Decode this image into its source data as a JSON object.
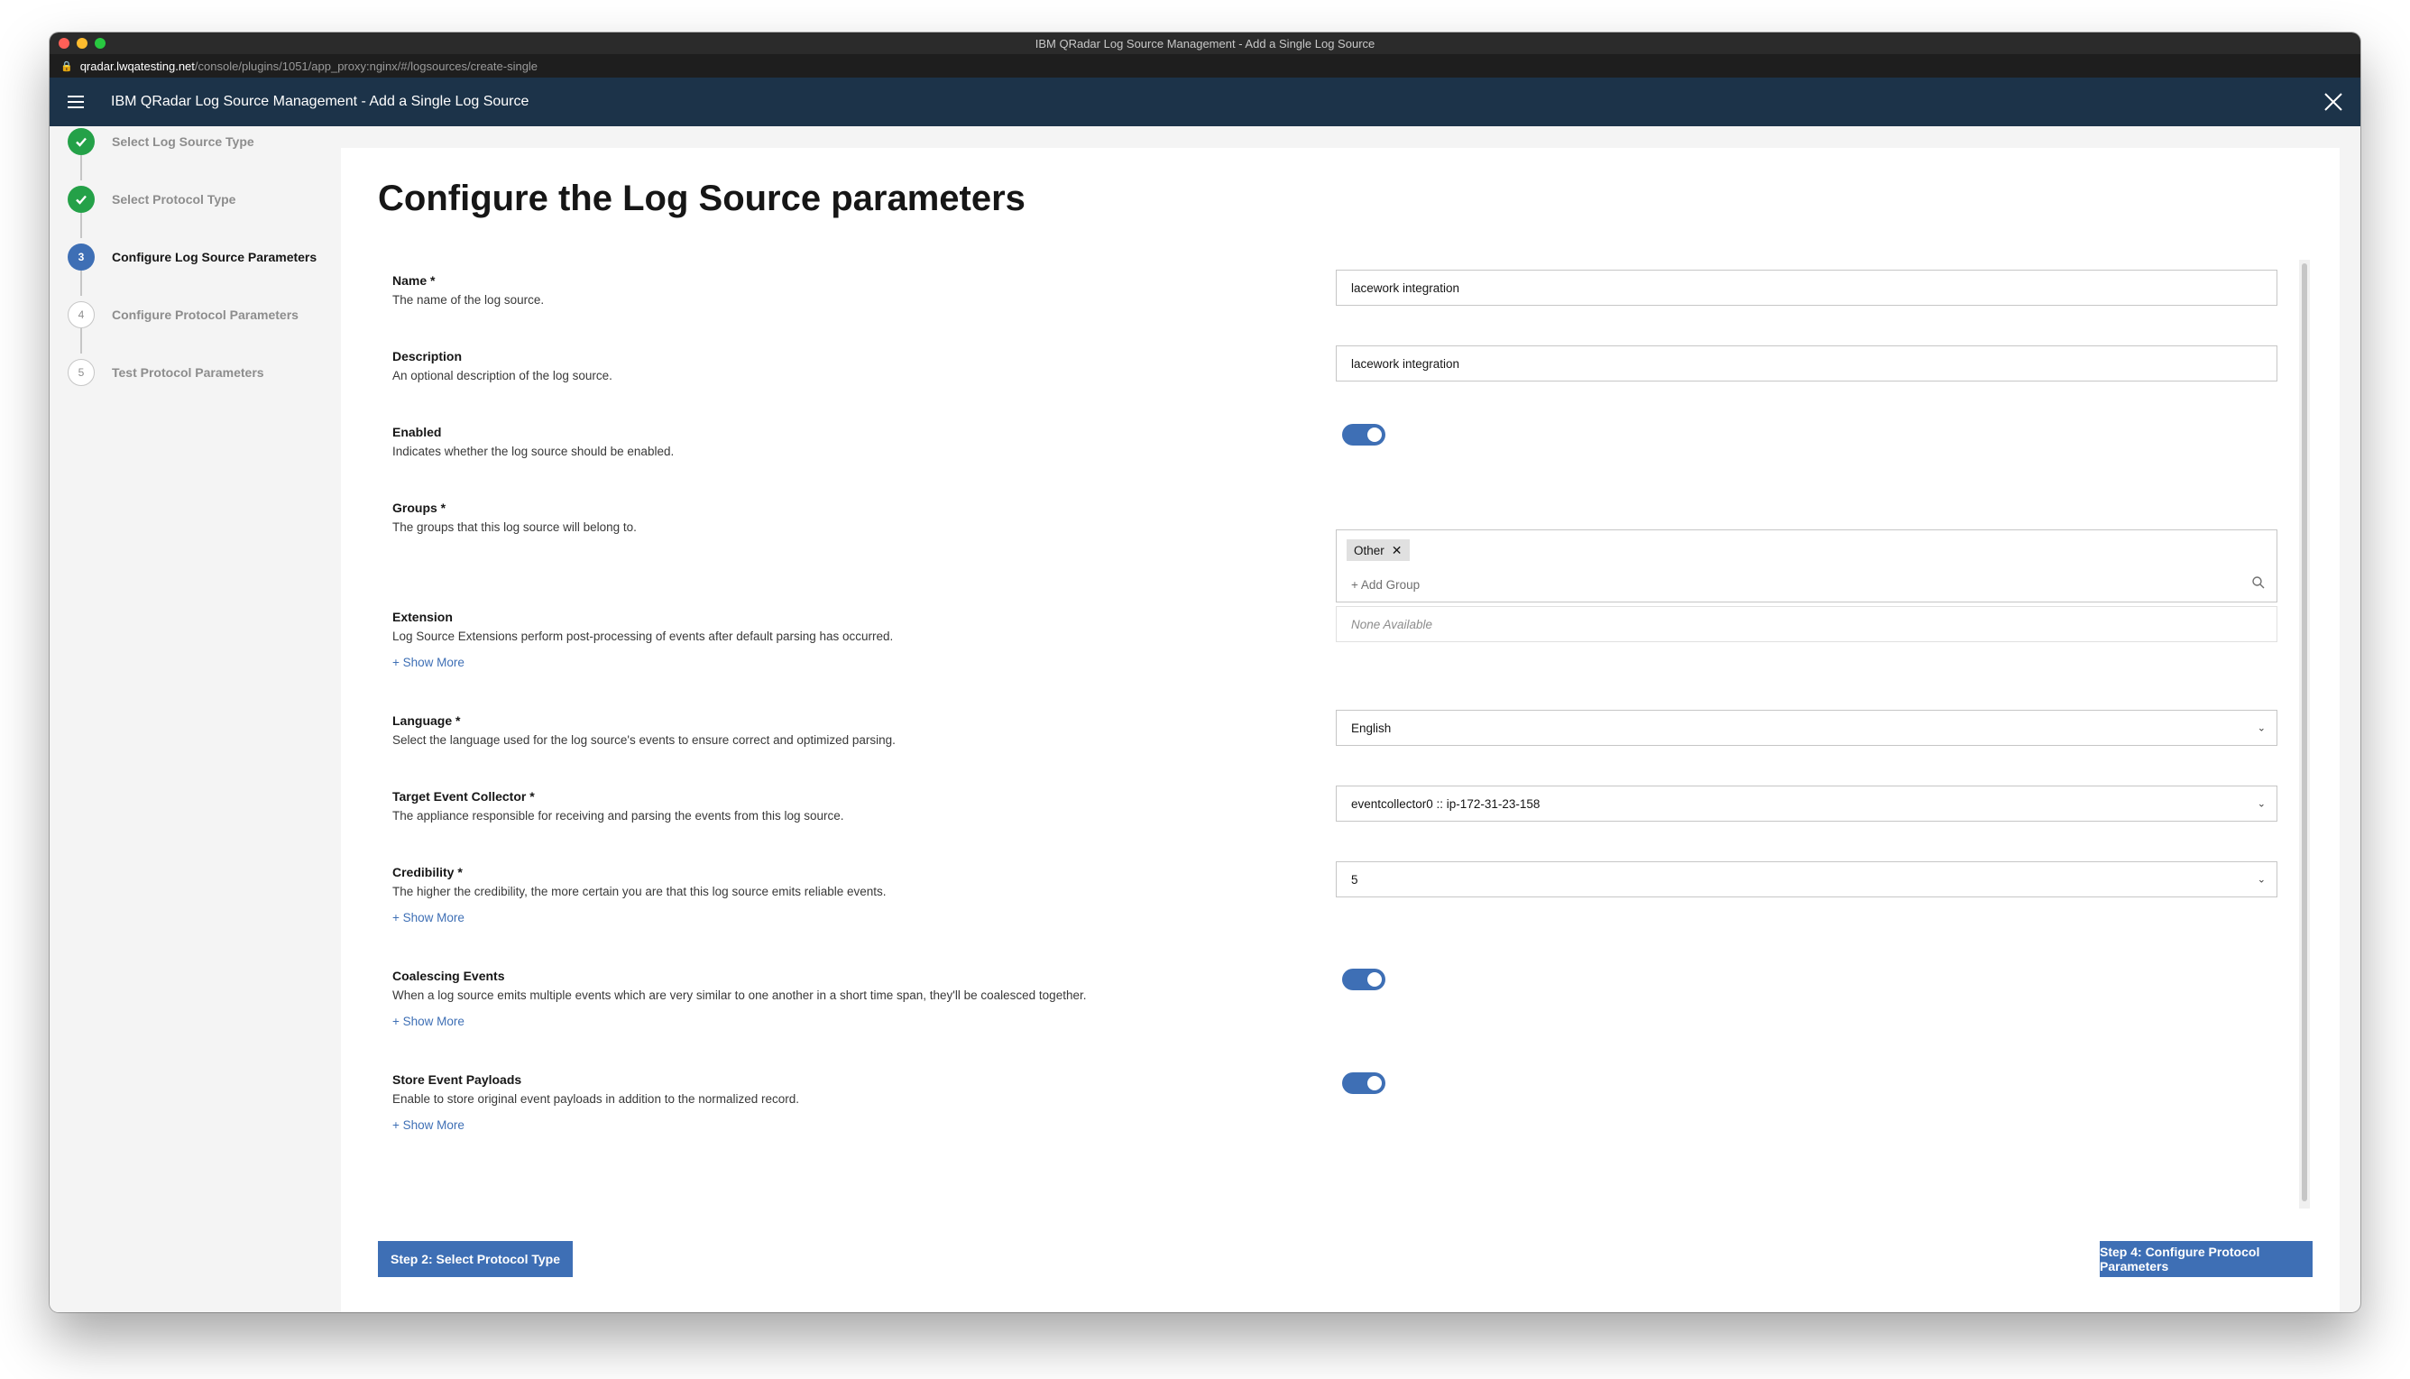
{
  "window": {
    "title": "IBM QRadar Log Source Management - Add a Single Log Source",
    "url_host": "qradar.lwqatesting.net",
    "url_path": "/console/plugins/1051/app_proxy:nginx/#/logsources/create-single"
  },
  "header": {
    "title": "IBM QRadar Log Source Management - Add a Single Log Source"
  },
  "steps": [
    {
      "number": "1",
      "label": "Select Log Source Type",
      "state": "complete"
    },
    {
      "number": "2",
      "label": "Select Protocol Type",
      "state": "complete"
    },
    {
      "number": "3",
      "label": "Configure Log Source Parameters",
      "state": "current"
    },
    {
      "number": "4",
      "label": "Configure Protocol Parameters",
      "state": "future"
    },
    {
      "number": "5",
      "label": "Test Protocol Parameters",
      "state": "future"
    }
  ],
  "page_title": "Configure the Log Source parameters",
  "fields": {
    "name": {
      "label": "Name *",
      "desc": "The name of the log source.",
      "value": "lacework integration"
    },
    "description": {
      "label": "Description",
      "desc": "An optional description of the log source.",
      "value": "lacework integration"
    },
    "enabled": {
      "label": "Enabled",
      "desc": "Indicates whether the log source should be enabled.",
      "on": true
    },
    "groups": {
      "label": "Groups *",
      "desc": "The groups that this log source will belong to.",
      "tag": "Other",
      "add_label": "+ Add Group"
    },
    "extension": {
      "label": "Extension",
      "desc": "Log Source Extensions perform post-processing of events after default parsing has occurred.",
      "show_more": "+ Show More",
      "value": "None Available"
    },
    "language": {
      "label": "Language *",
      "desc": "Select the language used for the log source's events to ensure correct and optimized parsing.",
      "value": "English"
    },
    "collector": {
      "label": "Target Event Collector *",
      "desc": "The appliance responsible for receiving and parsing the events from this log source.",
      "value": "eventcollector0 :: ip-172-31-23-158"
    },
    "credibility": {
      "label": "Credibility *",
      "desc": "The higher the credibility, the more certain you are that this log source emits reliable events.",
      "show_more": "+ Show More",
      "value": "5"
    },
    "coalescing": {
      "label": "Coalescing Events",
      "desc": "When a log source emits multiple events which are very similar to one another in a short time span, they'll be coalesced together.",
      "show_more": "+ Show More",
      "on": true
    },
    "payloads": {
      "label": "Store Event Payloads",
      "desc": "Enable to store original event payloads in addition to the normalized record.",
      "show_more": "+ Show More",
      "on": true
    }
  },
  "buttons": {
    "back": "Step 2: Select Protocol Type",
    "next": "Step 4: Configure Protocol Parameters"
  },
  "colors": {
    "accent": "#3e6fb5",
    "header_bg": "#1c3349",
    "success": "#24a148"
  }
}
